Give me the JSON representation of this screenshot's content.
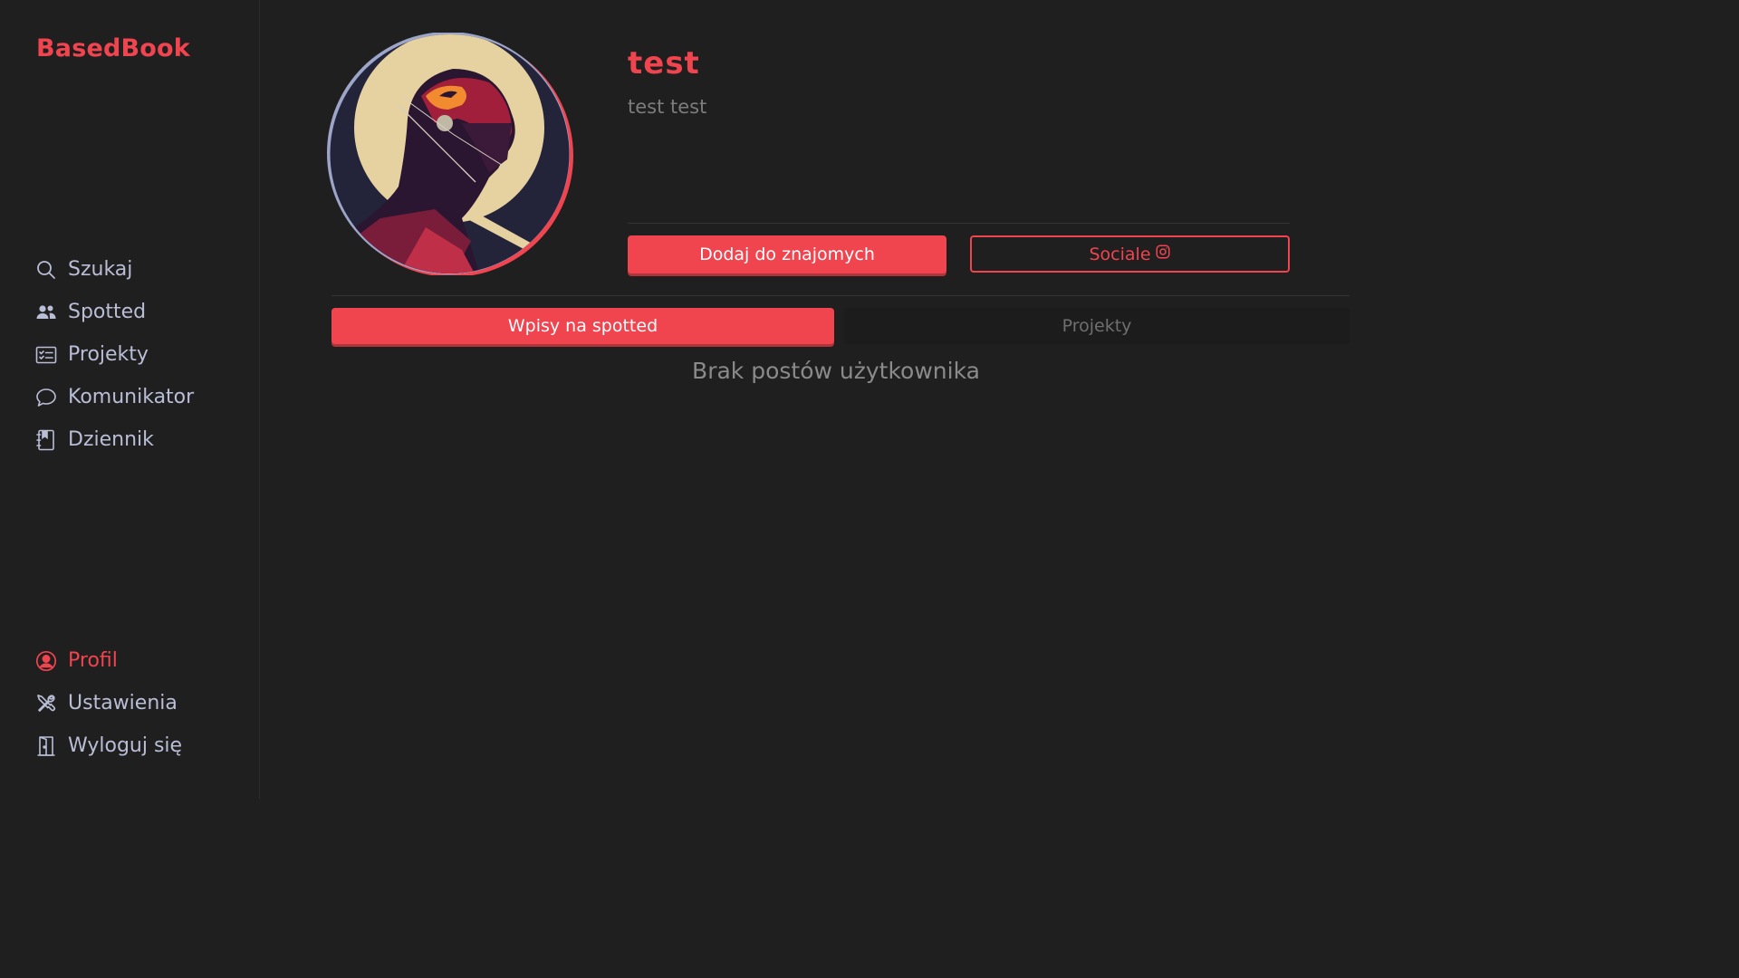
{
  "sidebar": {
    "logo": "BasedBook",
    "nav_top": [
      {
        "label": "Szukaj",
        "icon": "search-icon"
      },
      {
        "label": "Spotted",
        "icon": "users-icon"
      },
      {
        "label": "Projekty",
        "icon": "checklist-icon"
      },
      {
        "label": "Komunikator",
        "icon": "chat-bubble-icon"
      },
      {
        "label": "Dziennik",
        "icon": "journal-icon"
      }
    ],
    "nav_bottom": [
      {
        "label": "Profil",
        "icon": "user-circle-icon",
        "active": true
      },
      {
        "label": "Ustawienia",
        "icon": "tools-icon"
      },
      {
        "label": "Wyloguj się",
        "icon": "door-icon"
      }
    ]
  },
  "profile": {
    "name": "test",
    "subtitle": "test test",
    "add_friend_label": "Dodaj do znajomych",
    "socials_label": "Sociale",
    "socials_icon": "instagram-icon"
  },
  "tabs": {
    "posts_label": "Wpisy na spotted",
    "projects_label": "Projekty"
  },
  "content": {
    "empty_message": "Brak postów użytkownika"
  },
  "colors": {
    "accent": "#f0444f",
    "background": "#1f1f1f",
    "nav_text": "#b9bdd6"
  }
}
